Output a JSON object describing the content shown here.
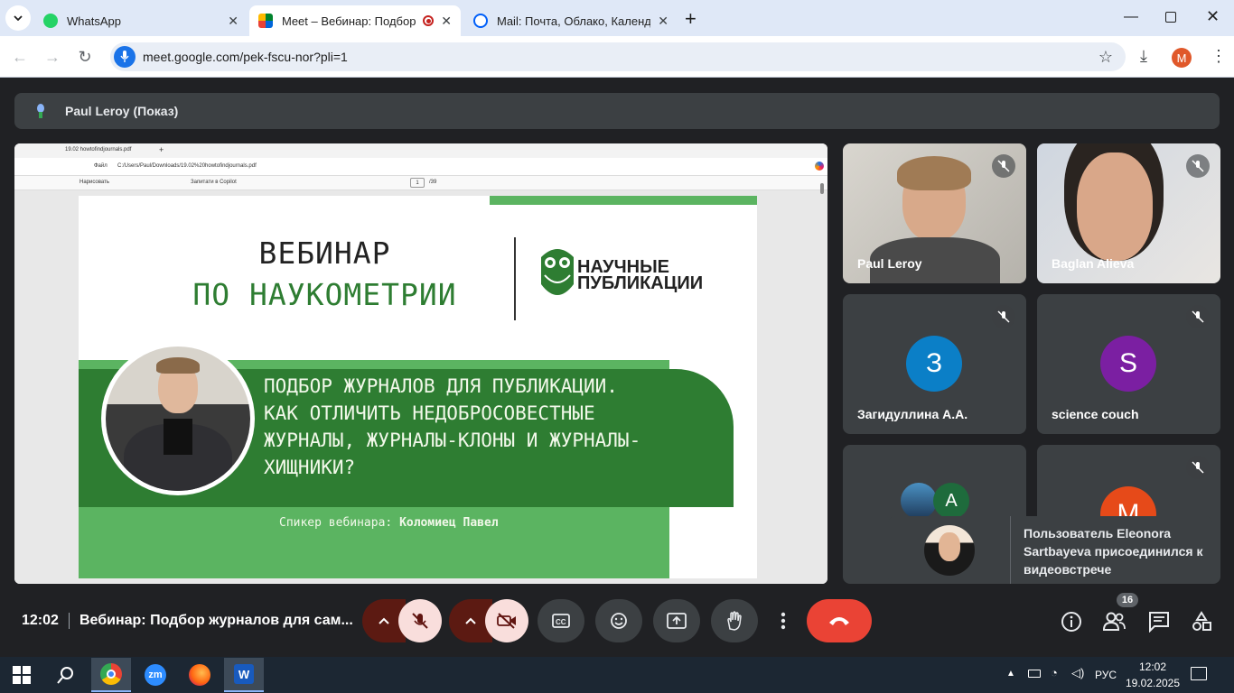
{
  "browser": {
    "tabs": [
      {
        "title": "WhatsApp",
        "icon": "whatsapp-icon",
        "active": false
      },
      {
        "title": "Meet – Вебинар: Подбор жу",
        "icon": "google-meet-icon",
        "active": true
      },
      {
        "title": "Mail: Почта, Облако, Календар",
        "icon": "mail-icon",
        "active": false
      }
    ],
    "url": "meet.google.com/pek-fscu-nor?pli=1",
    "profile_initial": "M"
  },
  "meet": {
    "presenter_label": "Paul Leroy (Показ)",
    "time": "12:02",
    "meeting_title": "Вебинар: Подбор журналов для сам...",
    "participant_count": "16",
    "toast_text": "Пользователь Eleonora Sartbayeva присоединился к видеовстрече",
    "participants": [
      {
        "name": "Paul Leroy",
        "initial": "",
        "color": ""
      },
      {
        "name": "Baglan Alieva",
        "initial": "",
        "color": ""
      },
      {
        "name": "Загидуллина А.А.",
        "initial": "З",
        "color": "#0b7fc7"
      },
      {
        "name": "science couch",
        "initial": "S",
        "color": "#7b1fa2"
      },
      {
        "name": "",
        "initial": "A",
        "color": "#1e6b3c"
      },
      {
        "name": "",
        "initial": "M",
        "color": "#e64a19"
      }
    ]
  },
  "pdf": {
    "tab_title": "19.02 howtofindjournals.pdf",
    "file_label": "Файл",
    "path": "C:/Users/Paul/Downloads/19.02%20howtofindjournals.pdf",
    "draw_label": "Нарисовать",
    "copilot_label": "Запитати в Copilot",
    "page_current": "1",
    "page_total": "/39"
  },
  "slide": {
    "title_line1": "ВЕБИНАР",
    "title_line2": "ПО НАУКОМЕТРИИ",
    "brand_line1": "НАУЧНЫЕ",
    "brand_line2": "ПУБЛИКАЦИИ",
    "topic_lines": [
      "ПОДБОР ЖУРНАЛОВ ДЛЯ ПУБЛИКАЦИИ.",
      "КАК ОТЛИЧИТЬ НЕДОБРОСОВЕСТНЫЕ",
      "ЖУРНАЛЫ, ЖУРНАЛЫ-КЛОНЫ И ЖУРНАЛЫ-",
      "ХИЩНИКИ?"
    ],
    "speaker_label": "Спикер вебинара:",
    "speaker_name": "Коломиец Павел"
  },
  "taskbar": {
    "apps": [
      "windows-start-icon",
      "search-icon",
      "chrome-icon",
      "zoom-icon",
      "firefox-icon",
      "word-icon"
    ],
    "zoom_label": "zm",
    "language": "РУС",
    "time": "12:02",
    "date": "19.02.2025"
  },
  "colors": {
    "meet_bg": "#202124",
    "tile_bg": "#3c4043",
    "slide_green_dark": "#2e7d32",
    "slide_green_light": "#5bb461",
    "end_call": "#ea4335"
  }
}
